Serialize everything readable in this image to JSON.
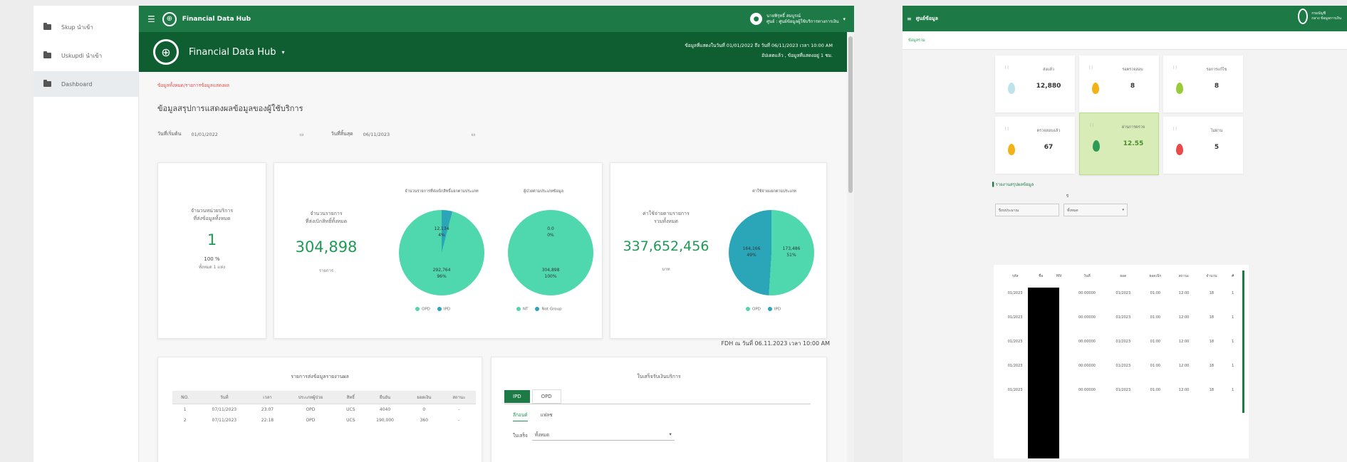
{
  "left_app": {
    "sidebar": {
      "items": [
        {
          "label": "Skup นำเข้า"
        },
        {
          "label": "Uskupdi นำเข้า"
        },
        {
          "label": "Dashboard"
        }
      ]
    },
    "topbar": {
      "title": "Financial Data Hub",
      "user_name": "นายพิรุทธิ์ สมบูรณ์",
      "user_org": "ศูนย์ : ศูนย์ข้อมูลผู้ใช้บริการทางการเงิน"
    },
    "banner": {
      "title": "Financial Data Hub",
      "info_line1": "ข้อมูลที่แสดงในวันที่ 01/01/2022 ถึง วันที่ 06/11/2023 เวลา 10:00 AM",
      "info_line2": "อัปเดตแล้ว , ข้อมูลที่แสดงอยู่ 1 ชม."
    },
    "breadcrumb": "ข้อมูลทั้งหมด/รายการข้อมูลแสดงผล",
    "page_title": "ข้อมูลสรุปการแสดงผลข้อมูลของผู้ใช้บริการ",
    "filters": {
      "start_label": "วันที่เริ่มต้น",
      "start_value": "01/01/2022",
      "end_label": "วันที่สิ้นสุด",
      "end_value": "06/11/2023"
    },
    "card1": {
      "label1": "จำนวนหน่วยบริการ",
      "label2": "ที่ส่งข้อมูลทั้งหมด",
      "value": "1",
      "percent": "100 %",
      "sub": "ทั้งหมด 1 แห่ง"
    },
    "card2": {
      "label1": "จำนวนรายการ",
      "label2": "ที่ส่งเบิกสิทธิ์ทั้งหมด",
      "value": "304,898",
      "unit": "รายการ",
      "pie1_title": "จำนวนรายการที่ส่งเบิกสิทธิ์แยกตามประเภท",
      "pie1_a": "12,134",
      "pie1_a_pct": "4%",
      "pie1_b": "292,764",
      "pie1_b_pct": "96%",
      "pie1_legend": [
        "OPD",
        "IPD"
      ],
      "pie2_title": "ผู้ป่วยตามประเภทข้อมูล",
      "pie2_a": "0.0",
      "pie2_a_pct": "0%",
      "pie2_b": "304,898",
      "pie2_b_pct": "100%",
      "pie2_legend": [
        "NT",
        "Not Group"
      ]
    },
    "card3": {
      "label1": "ค่าใช้จ่ายตามรายการ",
      "label2": "รวมทั้งหมด",
      "value": "337,652,456",
      "unit": "บาท",
      "pie_title": "ค่าใช้จ่ายแยกตามประเภท",
      "pie_a": "164,166",
      "pie_a_pct": "49%",
      "pie_b": "173,486",
      "pie_b_pct": "51%",
      "pie_legend": [
        "OPD",
        "IPD"
      ]
    },
    "fdi_timestamp": "FDH ณ วันที่ 06.11.2023 เวลา 10:00 AM",
    "table": {
      "title": "รายการส่งข้อมูลรายงานผล",
      "headers": [
        "NO.",
        "วันที่",
        "เวลา",
        "ประเภทผู้ป่วย",
        "สิทธิ์",
        "ยืนยัน",
        "ยอดเงิน",
        "สถานะ"
      ],
      "rows": [
        [
          "1",
          "07/11/2023",
          "23:07",
          "OPD",
          "UCS",
          "4040",
          "0",
          "-"
        ],
        [
          "2",
          "07/11/2023",
          "22:18",
          "OPD",
          "UCS",
          "190,000",
          "360",
          "-"
        ]
      ]
    },
    "right_panel": {
      "title": "ใบเสร็จรับเงินบริการ",
      "tabs": [
        "IPD",
        "OPD"
      ],
      "subtabs": [
        "ลีกอนต์",
        "แฟลช"
      ],
      "select_label": "ใบเสร็จ",
      "select_value": "ทั้งหมด"
    }
  },
  "right_app": {
    "topbar": {
      "title": "ศูนย์ข้อมูล",
      "seal_line1": "กรมบัญชี",
      "seal_line2": "กลาง ข้อมูลการเงิน"
    },
    "subbar": "ข้อมูลรวม",
    "tiles": [
      {
        "label": "ส่งแล้ว",
        "value": "12,880",
        "color": "#bfe3ea"
      },
      {
        "label": "รอตรวจสอบ",
        "value": "8",
        "color": "#f2b318"
      },
      {
        "label": "รอการแก้ไข",
        "value": "8",
        "color": "#9acb3a"
      },
      {
        "label": "ตรวจสอบแล้ว",
        "value": "67",
        "color": "#f2b318"
      },
      {
        "label": "ผ่านการตรวจ",
        "value": "12.55",
        "color": "#2c9b56",
        "active": true
      },
      {
        "label": "ไม่ผ่าน",
        "value": "5",
        "color": "#e94b4b"
      }
    ],
    "filter_title": "รายงานสรุปผลข้อมูล",
    "filter_label": "ปี",
    "filter_value1": "ปีงบประมาณ",
    "filter_value2": "ทั้งหมด",
    "table": {
      "headers": [
        "รหัส",
        "ชื่อ",
        "HN",
        "วันที่",
        "ยอด",
        "ยอดเบิก",
        "สถานะ",
        "จำนวน",
        "#"
      ],
      "rows": [
        [
          "01/2023",
          "",
          "",
          "00:00000",
          "01/2023",
          "01:00",
          "12:00",
          "18",
          "1"
        ],
        [
          "01/2023",
          "",
          "",
          "00:00000",
          "01/2023",
          "01:00",
          "12:00",
          "18",
          "1"
        ],
        [
          "01/2023",
          "",
          "",
          "00:00000",
          "01/2023",
          "01:00",
          "12:00",
          "18",
          "1"
        ],
        [
          "01/2023",
          "",
          "",
          "00:00000",
          "01/2023",
          "01:00",
          "12:00",
          "18",
          "1"
        ],
        [
          "01/2023",
          "",
          "",
          "00:00000",
          "01/2023",
          "01:00",
          "12:00",
          "18",
          "1"
        ]
      ]
    }
  }
}
